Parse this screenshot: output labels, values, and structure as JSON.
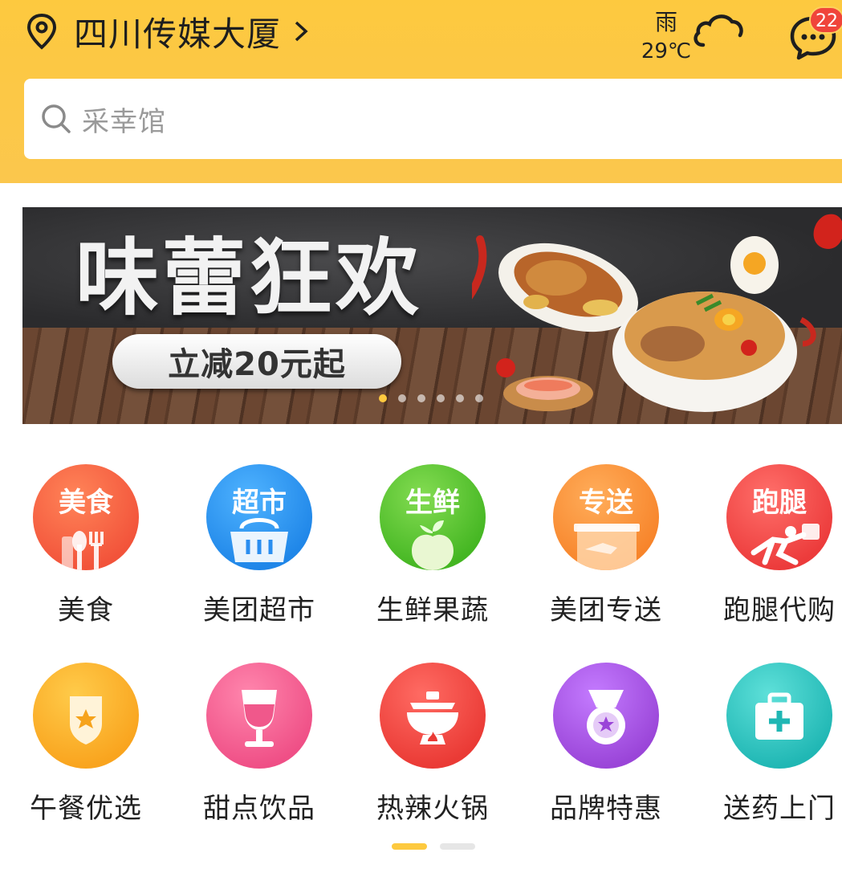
{
  "header": {
    "location": "四川传媒大厦",
    "weather_condition": "雨",
    "temperature": "29℃",
    "message_badge": "22"
  },
  "search": {
    "placeholder": "采幸馆"
  },
  "banner": {
    "title": "味蕾狂欢",
    "subtitle": "立减20元起",
    "slide_count": 6,
    "active_slide": 1
  },
  "categories": [
    {
      "icon_text": "美食",
      "label": "美食",
      "icon": "food-icon",
      "color": "#f45a3c"
    },
    {
      "icon_text": "超市",
      "label": "美团超市",
      "icon": "supermarket-icon",
      "color": "#2196f3"
    },
    {
      "icon_text": "生鲜",
      "label": "生鲜果蔬",
      "icon": "fresh-produce-icon",
      "color": "#53c22b"
    },
    {
      "icon_text": "专送",
      "label": "美团专送",
      "icon": "delivery-icon",
      "color": "#fb8a2c"
    },
    {
      "icon_text": "跑腿",
      "label": "跑腿代购",
      "icon": "errand-icon",
      "color": "#f04848"
    },
    {
      "icon_text": "",
      "label": "午餐优选",
      "icon": "lunch-badge-icon",
      "color": "#fbaa22"
    },
    {
      "icon_text": "",
      "label": "甜点饮品",
      "icon": "dessert-drink-icon",
      "color": "#f25a8e"
    },
    {
      "icon_text": "",
      "label": "热辣火锅",
      "icon": "hotpot-icon",
      "color": "#f0463e"
    },
    {
      "icon_text": "",
      "label": "品牌特惠",
      "icon": "brand-deal-icon",
      "color": "#a757e0"
    },
    {
      "icon_text": "",
      "label": "送药上门",
      "icon": "medicine-kit-icon",
      "color": "#2ec4c0"
    }
  ],
  "pager": {
    "pages": 2,
    "active": 1
  }
}
